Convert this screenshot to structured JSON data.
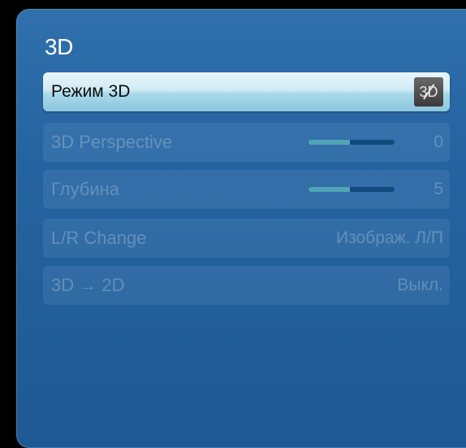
{
  "menu": {
    "title": "3D",
    "items": [
      {
        "label": "Режим 3D",
        "icon": "3d-off-icon",
        "icon_text": "3D",
        "selected": true
      },
      {
        "label": "3D Perspective",
        "slider_fraction": 0.48,
        "value": "0"
      },
      {
        "label": "Глубина",
        "slider_fraction": 0.48,
        "value": "5"
      },
      {
        "label": "L/R Change",
        "value": "Изображ. Л/П"
      },
      {
        "label": "3D → 2D",
        "value": "Выкл."
      }
    ]
  },
  "colors": {
    "panel_bg": "#2563a0",
    "selected_row": "#a9d9ea",
    "slider_fill": "#4fa5b6",
    "slider_track": "#124a7e",
    "disabled_text": "#8aa7c4"
  }
}
